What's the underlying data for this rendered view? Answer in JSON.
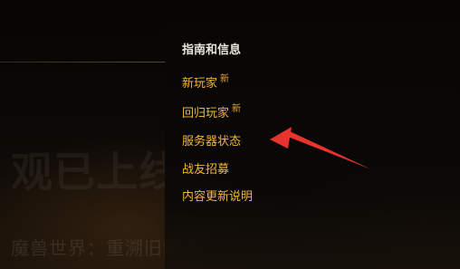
{
  "background": {
    "headline": "观已上线",
    "subline": "魔兽世界：重溯旧章的"
  },
  "menu": {
    "heading": "指南和信息",
    "items": [
      {
        "label": "新玩家",
        "badge": "新"
      },
      {
        "label": "回归玩家",
        "badge": "新"
      },
      {
        "label": "服务器状态",
        "badge": ""
      },
      {
        "label": "战友招募",
        "badge": ""
      },
      {
        "label": "内容更新说明",
        "badge": ""
      }
    ]
  },
  "colors": {
    "accent": "#f2b53a",
    "badge": "#e8a431",
    "heading": "#e8e4da",
    "annotation_arrow": "#e8332e"
  }
}
